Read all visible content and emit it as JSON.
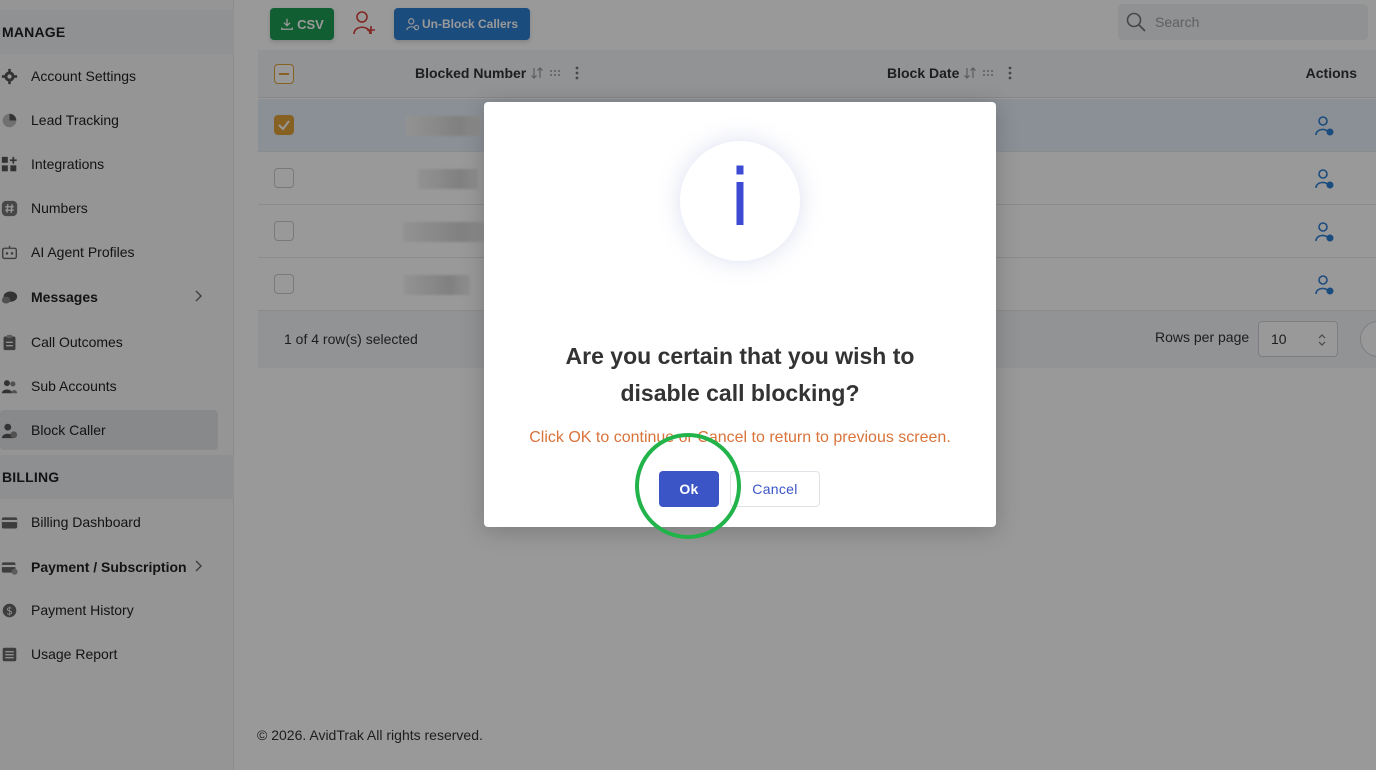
{
  "sidebar": {
    "manage_heading": "MANAGE",
    "billing_heading": "BILLING",
    "manage_items": [
      {
        "label": "Account Settings",
        "icon": "gear-icon"
      },
      {
        "label": "Lead Tracking",
        "icon": "pie-chart-icon"
      },
      {
        "label": "Integrations",
        "icon": "grid-plus-icon"
      },
      {
        "label": "Numbers",
        "icon": "hash-icon"
      },
      {
        "label": "AI Agent Profiles",
        "icon": "robot-icon"
      },
      {
        "label": "Messages",
        "icon": "chat-icon"
      },
      {
        "label": "Call Outcomes",
        "icon": "clipboard-icon"
      },
      {
        "label": "Sub Accounts",
        "icon": "users-icon"
      },
      {
        "label": "Block Caller",
        "icon": "user-block-icon"
      }
    ],
    "billing_items": [
      {
        "label": "Billing Dashboard",
        "icon": "card-icon"
      },
      {
        "label": "Payment / Subscription",
        "icon": "card-refresh-icon"
      },
      {
        "label": "Payment History",
        "icon": "dollar-icon"
      },
      {
        "label": "Usage Report",
        "icon": "report-icon"
      }
    ]
  },
  "toolbar": {
    "csv_label": "CSV",
    "unblock_label": "Un-Block Callers",
    "search_placeholder": "Search"
  },
  "table": {
    "columns": [
      "Blocked Number",
      "Block Date",
      "Actions"
    ],
    "selection_text": "1 of 4 row(s) selected",
    "rows_per_page_label": "Rows per page",
    "rows_per_page_value": "10"
  },
  "footer": {
    "copyright": "© 2026. AvidTrak All rights reserved."
  },
  "modal": {
    "icon_glyph": "i",
    "title": "Are you certain that you wish to disable call blocking?",
    "subtitle": "Click OK to continue or Cancel to return to previous screen.",
    "ok_label": "Ok",
    "cancel_label": "Cancel"
  },
  "colors": {
    "accent_blue": "#3b55c7",
    "csv_green": "#1f9d55",
    "checkbox_orange": "#e0a23a",
    "subtitle_orange": "#d9733a",
    "highlight_green": "#22b34a"
  }
}
